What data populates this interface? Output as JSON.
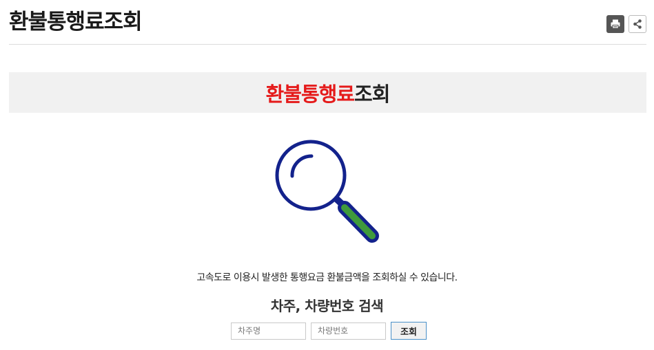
{
  "page": {
    "title": "환불통행료조회"
  },
  "toolbar": {
    "print_icon": "printer-icon",
    "share_icon": "share-icon"
  },
  "banner": {
    "highlight": "환불통행료",
    "rest": "조회",
    "highlight_color": "#e51a1a",
    "background": "#f1f1f1"
  },
  "illustration": {
    "icon": "magnifying-glass-icon",
    "lens_color": "#13228c",
    "handle_color": "#3f9a3c"
  },
  "main": {
    "description": "고속도로 이용시 발생한 통행요금 환불금액을 조회하실 수 있습니다.",
    "search_title": "차주, 차량번호 검색"
  },
  "search": {
    "owner_placeholder": "차주명",
    "owner_value": "",
    "plate_placeholder": "차량번호",
    "plate_value": "",
    "button_label": "조회"
  }
}
